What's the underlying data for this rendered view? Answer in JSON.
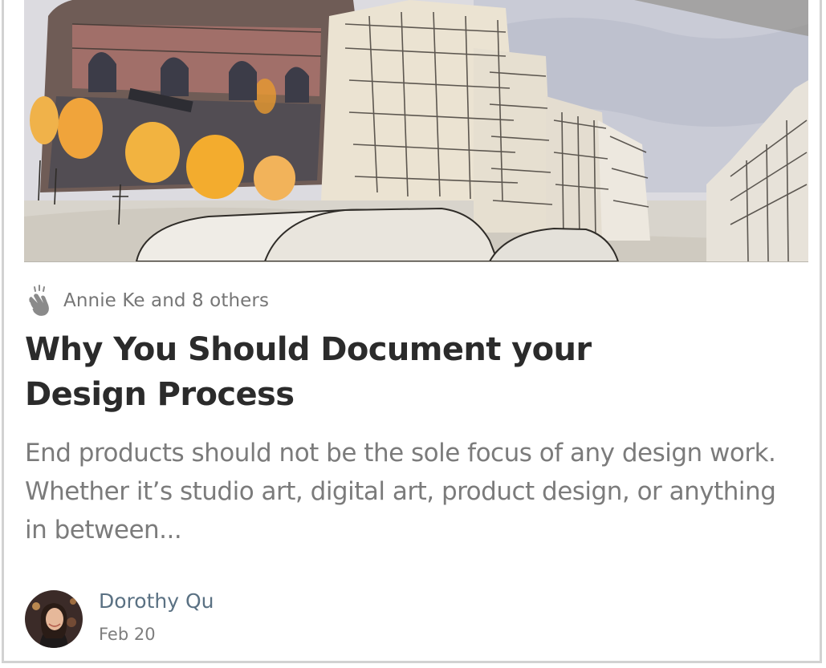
{
  "post": {
    "hero_image_alt": "Watercolor street sketch",
    "recommend_icon": "clap-icon",
    "recommend_text": "Annie Ke and 8 others",
    "title_line1": "Why You Should Document your",
    "title_line2": "Design Process",
    "excerpt_line1": "End products should not be the sole focus of any design work.",
    "excerpt_line2": "Whether it’s studio art, digital art, product design, or anything",
    "excerpt_line3": "in between...",
    "author_name": "Dorothy Qu",
    "date": "Feb 20"
  },
  "colors": {
    "title": "#2b2b2b",
    "meta_gray": "#767676",
    "author_link": "#5a7183",
    "border": "#d2d2d2"
  }
}
